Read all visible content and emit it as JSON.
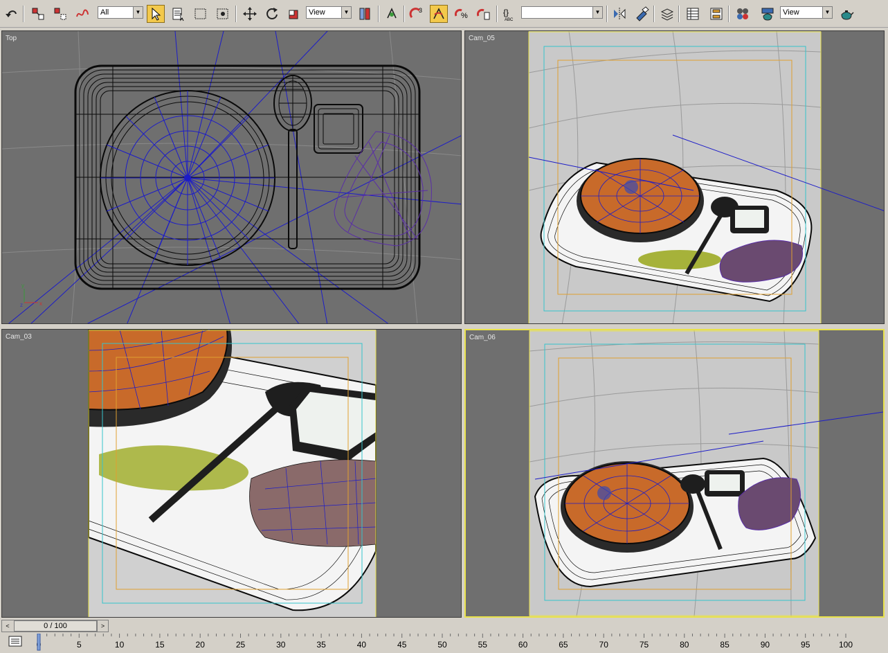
{
  "toolbar": {
    "selection_filter": "All",
    "ref_coord_1": "View",
    "named_selection": "",
    "ref_coord_2": "View",
    "angle_snap_badge": "3",
    "icons": [
      "undo-icon",
      "select-link-icon",
      "unlink-icon",
      "bind-spacewarp-icon",
      "select-object-icon",
      "select-by-name-icon",
      "rect-region-icon",
      "window-crossing-icon",
      "move-icon",
      "rotate-icon",
      "scale-icon",
      "pivot-icon",
      "manipulate-icon",
      "snap-3-icon",
      "angle-snap-icon",
      "percent-snap-icon",
      "spinner-snap-icon",
      "edit-named-selection-icon",
      "mirror-icon",
      "align-icon",
      "layer-manager-icon",
      "curve-editor-icon",
      "schematic-view-icon",
      "material-editor-icon",
      "render-setup-icon",
      "render-teapot-icon"
    ]
  },
  "viewports": {
    "top": {
      "label": "Top"
    },
    "cam05": {
      "label": "Cam_05"
    },
    "cam03": {
      "label": "Cam_03"
    },
    "cam06": {
      "label": "Cam_06"
    }
  },
  "timeline": {
    "frame_display": "0 / 100",
    "current_frame": 0,
    "total_frames": 100,
    "tick_labels": [
      "0",
      "5",
      "10",
      "15",
      "20",
      "25",
      "30",
      "35",
      "40",
      "45",
      "50",
      "55",
      "60",
      "65",
      "70",
      "75",
      "80",
      "85",
      "90",
      "95",
      "100"
    ],
    "prev_glyph": "<",
    "next_glyph": ">"
  },
  "colors": {
    "viewport_bg": "#6f6f6f",
    "wire": "#0a0a0a",
    "blue_wire": "#1c1cc8",
    "purple_wire": "#5a2ea6",
    "soup": "#c86a2a",
    "safe_frame_yellow": "#e9e24a",
    "safe_frame_cyan": "#35c4cc",
    "safe_frame_orange": "#e0a030"
  }
}
